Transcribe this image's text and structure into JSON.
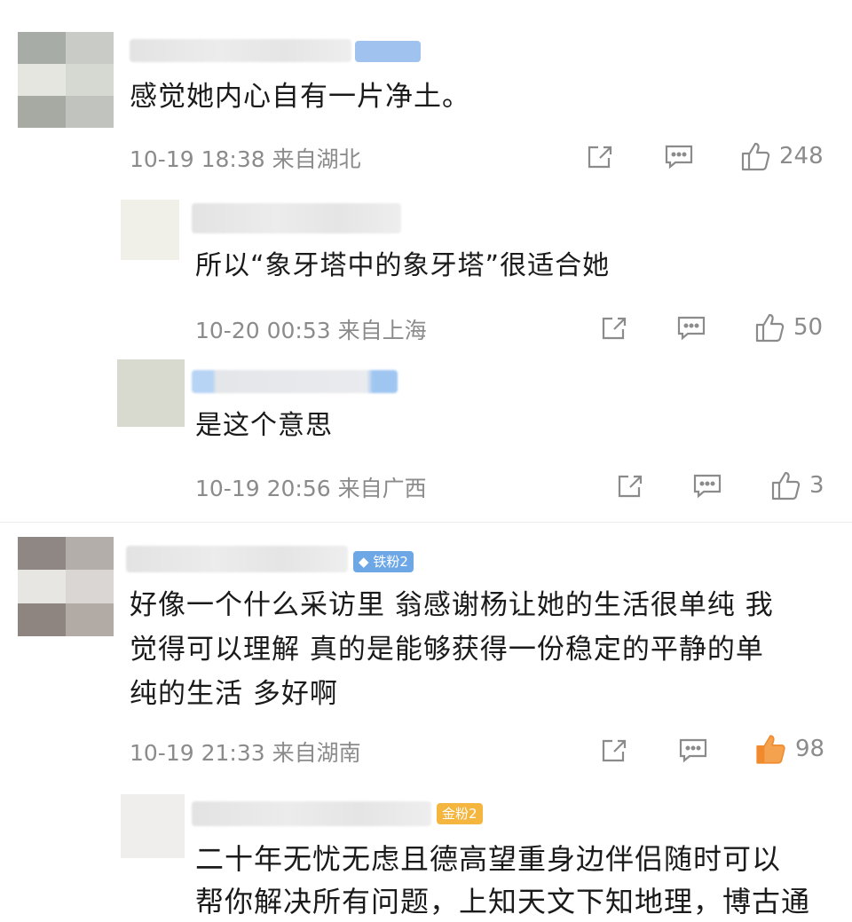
{
  "comments": [
    {
      "text": "感觉她内心自有一片净土。",
      "meta": "10-19 18:38 来自湖北",
      "likes": "248",
      "replies": [
        {
          "text": "所以“象牙塔中的象牙塔”很适合她",
          "meta": "10-20 00:53 来自上海",
          "likes": "50"
        },
        {
          "text": "是这个意思",
          "meta": "10-19 20:56 来自广西",
          "likes": "3"
        }
      ]
    },
    {
      "badge": "铁粉2",
      "text_lines": [
        "好像一个什么采访里 翁感谢杨让她的生活很单纯 我",
        "觉得可以理解 真的是能够获得一份稳定的平静的单",
        "纯的生活 多好啊"
      ],
      "meta": "10-19 21:33 来自湖南",
      "likes": "98",
      "liked": true,
      "replies": [
        {
          "badge": "金粉2",
          "text_lines": [
            "二十年无忧无虑且德高望重身边伴侣随时可以",
            "帮你解决所有问题，上知天文下知地理，博古通"
          ]
        }
      ]
    }
  ],
  "icons": {
    "share": "share-icon",
    "comment": "comment-icon",
    "like": "thumbs-up-icon"
  },
  "colors": {
    "liked": "#f08a2c",
    "meta": "#8b8b8b",
    "badge_iron": "#6ea7e6",
    "badge_gold": "#f5b640"
  }
}
